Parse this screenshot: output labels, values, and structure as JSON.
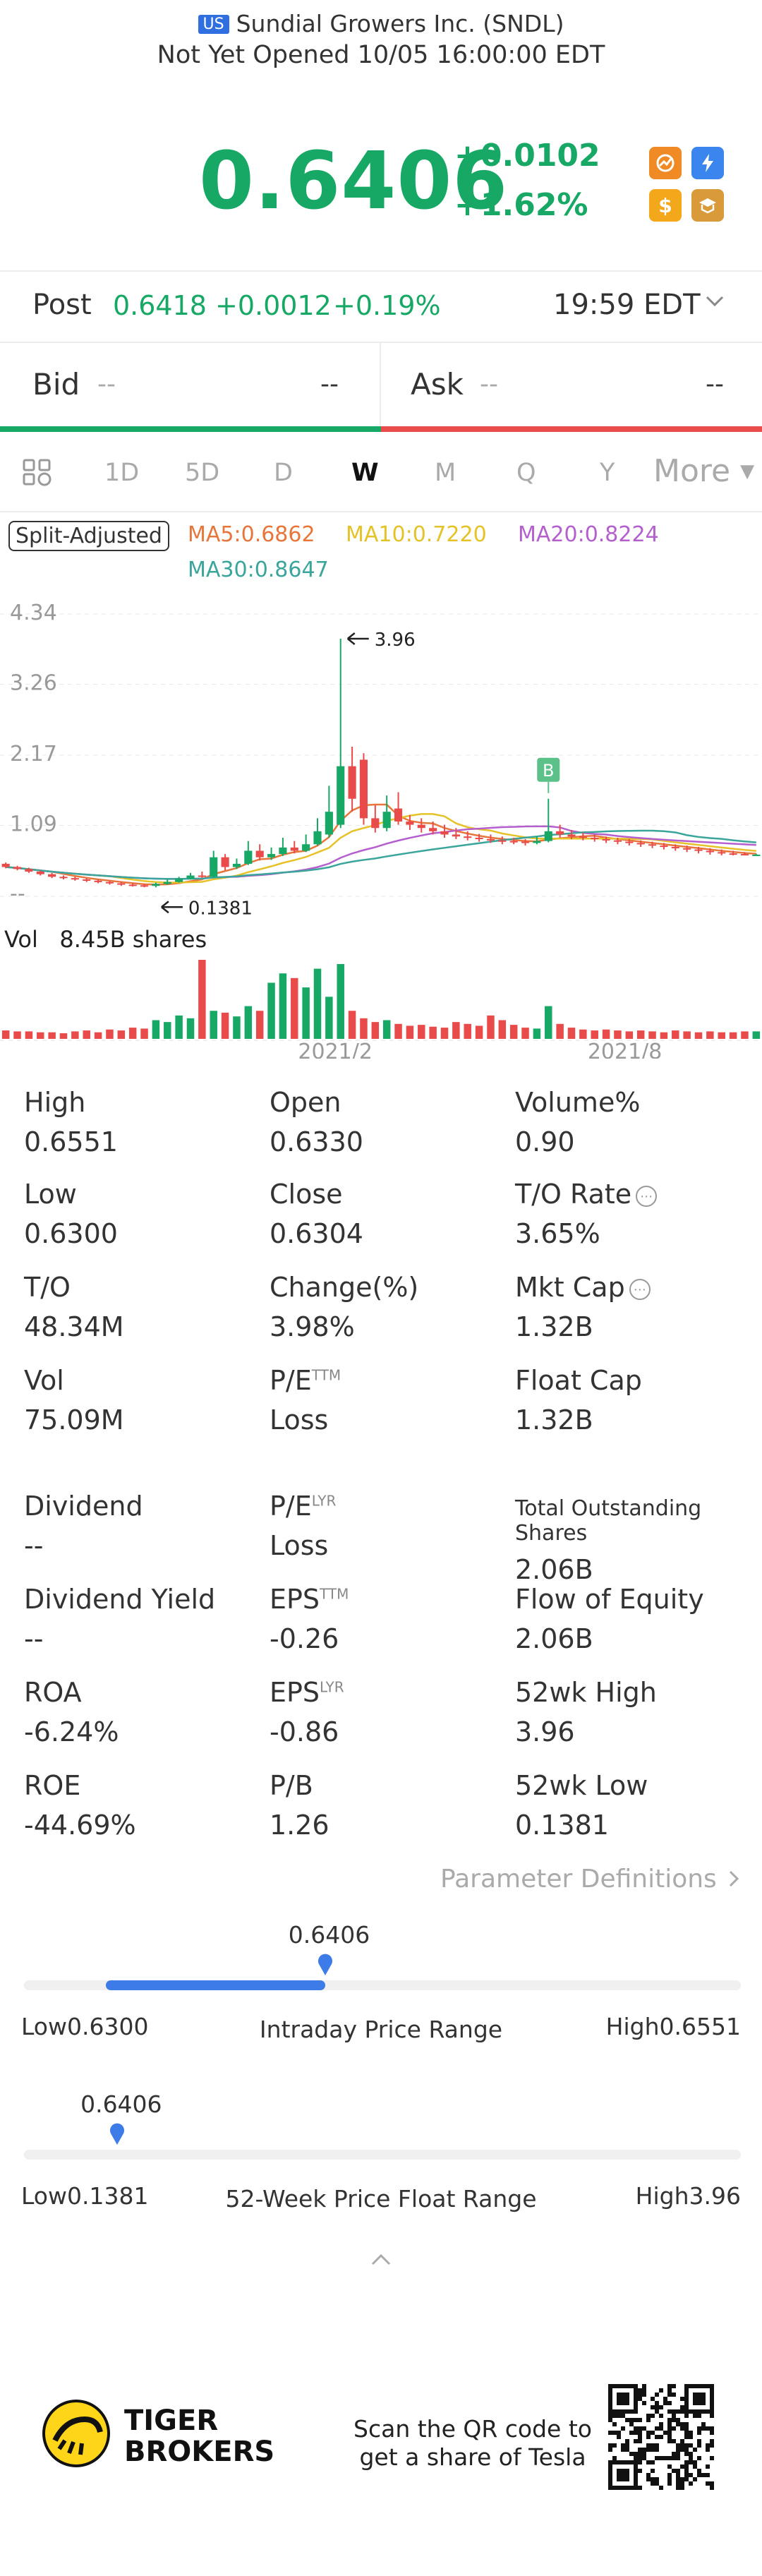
{
  "header": {
    "market_badge": "US",
    "company": "Sundial Growers Inc. (SNDL)",
    "status": "Not Yet Opened 10/05 16:00:00 EDT"
  },
  "quote": {
    "price": "0.6406",
    "change": "+0.0102",
    "change_pct": "+1.62%"
  },
  "post": {
    "label": "Post",
    "price": "0.6418",
    "change": "+0.0012",
    "change_pct": "+0.19%",
    "time": "19:59 EDT"
  },
  "bidask": {
    "bid_label": "Bid",
    "bid_price": "--",
    "bid_size": "--",
    "ask_label": "Ask",
    "ask_price": "--",
    "ask_size": "--"
  },
  "tabs": [
    "1D",
    "5D",
    "D",
    "W",
    "M",
    "Q",
    "Y",
    "More"
  ],
  "active_tab": "W",
  "legend": {
    "split_adjusted": "Split-Adjusted",
    "ma5": "MA5:0.6862",
    "ma10": "MA10:0.7220",
    "ma20": "MA20:0.8224",
    "ma30": "MA30:0.8647"
  },
  "colors": {
    "up": "#16a864",
    "down": "#e94a4a",
    "ma5": "#e8763a",
    "ma10": "#e6c229",
    "ma20": "#b55fcf",
    "ma30": "#3aa59a",
    "accent": "#3d7be8"
  },
  "chart_data": {
    "type": "candlestick",
    "y_tick_labels": [
      "4.34",
      "3.26",
      "2.17",
      "1.09",
      "--"
    ],
    "ylim": [
      0,
      4.34
    ],
    "x_tick_labels": [
      "2021/2",
      "2021/8"
    ],
    "annotations": {
      "high_label": "3.96",
      "low_label": "0.1381",
      "marker": "B"
    },
    "candles": [
      [
        0.5,
        0.45,
        0.52,
        0.43
      ],
      [
        0.45,
        0.42,
        0.47,
        0.4
      ],
      [
        0.42,
        0.38,
        0.44,
        0.36
      ],
      [
        0.38,
        0.34,
        0.4,
        0.32
      ],
      [
        0.34,
        0.3,
        0.36,
        0.28
      ],
      [
        0.3,
        0.28,
        0.32,
        0.26
      ],
      [
        0.28,
        0.26,
        0.3,
        0.24
      ],
      [
        0.26,
        0.24,
        0.28,
        0.22
      ],
      [
        0.24,
        0.22,
        0.26,
        0.2
      ],
      [
        0.22,
        0.2,
        0.24,
        0.18
      ],
      [
        0.2,
        0.18,
        0.22,
        0.16
      ],
      [
        0.18,
        0.17,
        0.2,
        0.15
      ],
      [
        0.17,
        0.16,
        0.19,
        0.14
      ],
      [
        0.16,
        0.19,
        0.21,
        0.1381
      ],
      [
        0.19,
        0.22,
        0.26,
        0.18
      ],
      [
        0.22,
        0.27,
        0.3,
        0.21
      ],
      [
        0.27,
        0.32,
        0.36,
        0.26
      ],
      [
        0.32,
        0.3,
        0.38,
        0.28
      ],
      [
        0.3,
        0.6,
        0.7,
        0.29
      ],
      [
        0.6,
        0.45,
        0.65,
        0.4
      ],
      [
        0.45,
        0.5,
        0.58,
        0.42
      ],
      [
        0.5,
        0.7,
        0.85,
        0.48
      ],
      [
        0.7,
        0.6,
        0.8,
        0.55
      ],
      [
        0.6,
        0.65,
        0.75,
        0.56
      ],
      [
        0.65,
        0.75,
        0.9,
        0.62
      ],
      [
        0.75,
        0.7,
        0.85,
        0.66
      ],
      [
        0.7,
        0.8,
        0.95,
        0.68
      ],
      [
        0.8,
        1.0,
        1.2,
        0.78
      ],
      [
        0.95,
        1.3,
        1.7,
        0.9
      ],
      [
        1.1,
        2.0,
        3.96,
        1.05
      ],
      [
        2.0,
        1.5,
        2.3,
        1.3
      ],
      [
        2.1,
        1.2,
        2.2,
        1.1
      ],
      [
        1.2,
        1.05,
        1.4,
        0.98
      ],
      [
        1.05,
        1.3,
        1.55,
        1.0
      ],
      [
        1.35,
        1.15,
        1.6,
        1.1
      ],
      [
        1.15,
        1.1,
        1.25,
        1.02
      ],
      [
        1.1,
        1.05,
        1.2,
        0.98
      ],
      [
        1.05,
        1.0,
        1.15,
        0.95
      ],
      [
        1.0,
        0.95,
        1.1,
        0.9
      ],
      [
        0.95,
        0.92,
        1.05,
        0.88
      ],
      [
        0.92,
        0.9,
        1.0,
        0.86
      ],
      [
        0.9,
        0.88,
        0.96,
        0.84
      ],
      [
        0.88,
        0.86,
        0.95,
        0.82
      ],
      [
        0.86,
        0.85,
        0.92,
        0.8
      ],
      [
        0.85,
        0.84,
        0.9,
        0.8
      ],
      [
        0.84,
        0.82,
        0.88,
        0.78
      ],
      [
        0.82,
        0.85,
        0.92,
        0.8
      ],
      [
        0.85,
        1.0,
        1.5,
        0.83
      ],
      [
        1.0,
        0.95,
        1.1,
        0.9
      ],
      [
        0.95,
        0.92,
        1.02,
        0.88
      ],
      [
        0.92,
        0.9,
        0.98,
        0.86
      ],
      [
        0.9,
        0.88,
        0.95,
        0.84
      ],
      [
        0.88,
        0.86,
        0.92,
        0.82
      ],
      [
        0.86,
        0.84,
        0.9,
        0.8
      ],
      [
        0.84,
        0.82,
        0.88,
        0.78
      ],
      [
        0.82,
        0.8,
        0.86,
        0.76
      ],
      [
        0.8,
        0.78,
        0.84,
        0.74
      ],
      [
        0.78,
        0.76,
        0.82,
        0.72
      ],
      [
        0.76,
        0.74,
        0.8,
        0.7
      ],
      [
        0.74,
        0.72,
        0.78,
        0.68
      ],
      [
        0.72,
        0.7,
        0.76,
        0.66
      ],
      [
        0.7,
        0.68,
        0.74,
        0.64
      ],
      [
        0.68,
        0.66,
        0.72,
        0.63
      ],
      [
        0.66,
        0.65,
        0.7,
        0.63
      ],
      [
        0.65,
        0.64,
        0.68,
        0.63
      ],
      [
        0.6304,
        0.6406,
        0.6551,
        0.63
      ]
    ],
    "volumes": [
      0.9,
      0.8,
      0.8,
      0.7,
      0.7,
      0.6,
      0.8,
      0.9,
      0.7,
      1.0,
      0.9,
      1.2,
      1.1,
      2.0,
      1.8,
      2.5,
      2.2,
      8.45,
      3.0,
      2.8,
      2.4,
      3.5,
      3.0,
      6.0,
      7.0,
      6.5,
      5.5,
      7.5,
      4.5,
      8.0,
      3.0,
      2.2,
      1.8,
      2.0,
      1.6,
      1.4,
      1.5,
      1.3,
      1.2,
      1.8,
      1.6,
      1.4,
      2.5,
      2.0,
      1.5,
      1.2,
      1.1,
      3.5,
      1.6,
      1.2,
      1.0,
      0.9,
      1.0,
      0.9,
      0.8,
      0.9,
      0.8,
      0.7,
      0.9,
      0.8,
      0.7,
      0.8,
      0.7,
      0.7,
      0.8,
      0.8
    ]
  },
  "volume": {
    "label": "Vol",
    "value": "8.45B shares"
  },
  "stats": [
    {
      "label": "High",
      "value": "0.6551"
    },
    {
      "label": "Open",
      "value": "0.6330"
    },
    {
      "label": "Volume%",
      "value": "0.90"
    },
    {
      "label": "Low",
      "value": "0.6300"
    },
    {
      "label": "Close",
      "value": "0.6304"
    },
    {
      "label": "T/O Rate",
      "value": "3.65%",
      "info": true
    },
    {
      "label": "T/O",
      "value": "48.34M"
    },
    {
      "label": "Change(%)",
      "value": "3.98%"
    },
    {
      "label": "Mkt Cap",
      "value": "1.32B",
      "info": true
    },
    {
      "label": "Vol",
      "value": "75.09M"
    },
    {
      "label": "P/E",
      "sup": "TTM",
      "value": "Loss"
    },
    {
      "label": "Float Cap",
      "value": "1.32B"
    },
    {
      "label": "Dividend",
      "value": "--"
    },
    {
      "label": "P/E",
      "sup": "LYR",
      "value": "Loss"
    },
    {
      "label": "Total Outstanding Shares",
      "value": "2.06B",
      "small": true
    },
    {
      "label": "Dividend Yield",
      "value": "--"
    },
    {
      "label": "EPS",
      "sup": "TTM",
      "value": "-0.26"
    },
    {
      "label": "Flow of Equity",
      "value": "2.06B"
    },
    {
      "label": "ROA",
      "value": "-6.24%"
    },
    {
      "label": "EPS",
      "sup": "LYR",
      "value": "-0.86"
    },
    {
      "label": "52wk High",
      "value": "3.96"
    },
    {
      "label": "ROE",
      "value": "-44.69%"
    },
    {
      "label": "P/B",
      "value": "1.26"
    },
    {
      "label": "52wk Low",
      "value": "0.1381"
    }
  ],
  "parameter_definitions": "Parameter Definitions",
  "intraday_range": {
    "current": "0.6406",
    "low_label": "Low",
    "low": "0.6300",
    "title": "Intraday Price Range",
    "high_label": "High",
    "high": "0.6551",
    "position": 0.42
  },
  "week52_range": {
    "current": "0.6406",
    "low_label": "Low",
    "low": "0.1381",
    "title": "52-Week Price Float Range",
    "high_label": "High",
    "high": "3.96",
    "position": 0.13
  },
  "footer": {
    "brand_line1": "TIGER",
    "brand_line2": "BROKERS",
    "promo_line1": "Scan the QR code to",
    "promo_line2": "get a share of Tesla"
  }
}
